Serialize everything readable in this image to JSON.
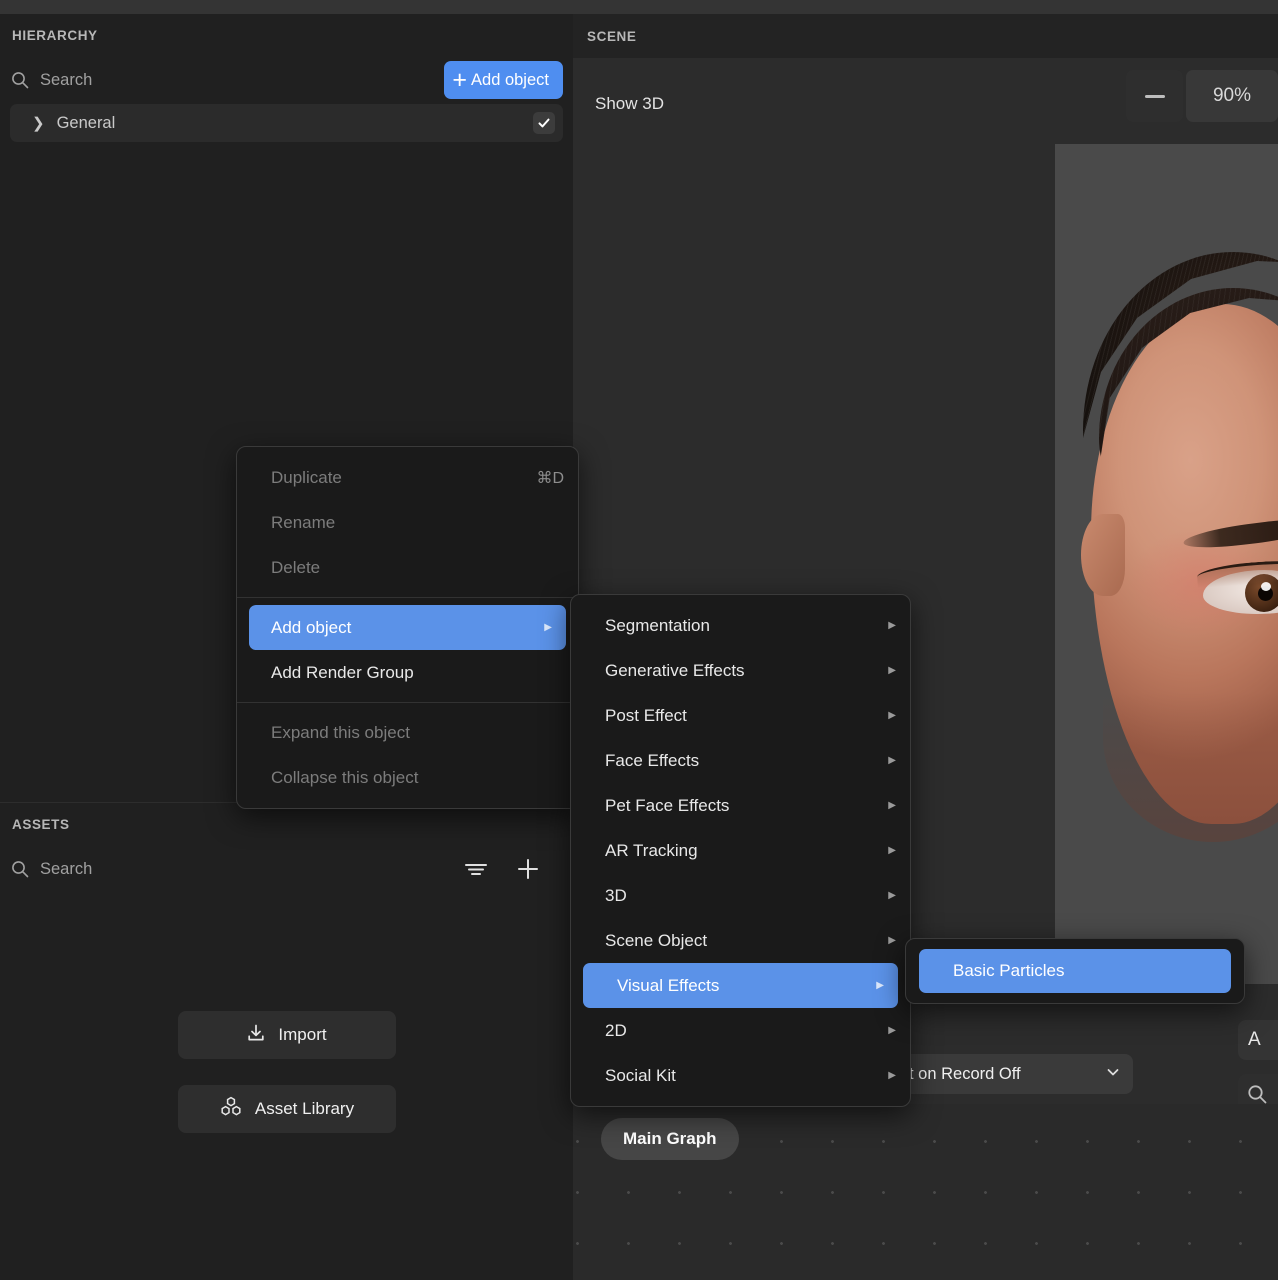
{
  "hierarchy": {
    "title": "HIERARCHY",
    "search_placeholder": "Search",
    "add_object_label": "Add object",
    "tree": [
      {
        "label": "General",
        "expanded": false,
        "enabled": true
      }
    ]
  },
  "assets": {
    "title": "ASSETS",
    "search_placeholder": "Search",
    "import_label": "Import",
    "asset_library_label": "Asset Library"
  },
  "scene": {
    "title": "SCENE",
    "show_3d_label": "Show 3D",
    "zoom_level": "90%",
    "zoom_out_label": "—"
  },
  "bottom": {
    "dropdown_value": "t on Record Off",
    "right_partial_label": "A",
    "graph_chip_label": "Main Graph"
  },
  "context_menu": {
    "items": [
      {
        "label": "Duplicate",
        "shortcut": "⌘D",
        "state": "disabled"
      },
      {
        "label": "Rename",
        "shortcut": "",
        "state": "disabled"
      },
      {
        "label": "Delete",
        "shortcut": "",
        "state": "disabled"
      },
      {
        "separator": true
      },
      {
        "label": "Add object",
        "shortcut": "",
        "state": "selected",
        "submenu": true
      },
      {
        "label": "Add Render Group",
        "shortcut": "",
        "state": "normal"
      },
      {
        "separator": true
      },
      {
        "label": "Expand this object",
        "shortcut": "",
        "state": "disabled"
      },
      {
        "label": "Collapse this object",
        "shortcut": "",
        "state": "disabled"
      }
    ]
  },
  "add_object_submenu": {
    "items": [
      {
        "label": "Segmentation",
        "state": "normal",
        "submenu": true
      },
      {
        "label": "Generative Effects",
        "state": "normal",
        "submenu": true
      },
      {
        "label": "Post Effect",
        "state": "normal",
        "submenu": true
      },
      {
        "label": "Face Effects",
        "state": "normal",
        "submenu": true
      },
      {
        "label": "Pet Face Effects",
        "state": "normal",
        "submenu": true
      },
      {
        "label": "AR Tracking",
        "state": "normal",
        "submenu": true
      },
      {
        "label": "3D",
        "state": "normal",
        "submenu": true
      },
      {
        "label": "Scene Object",
        "state": "normal",
        "submenu": true
      },
      {
        "label": "Visual Effects",
        "state": "selected",
        "submenu": true
      },
      {
        "label": "2D",
        "state": "normal",
        "submenu": true
      },
      {
        "label": "Social Kit",
        "state": "normal",
        "submenu": true
      }
    ]
  },
  "visual_effects_submenu": {
    "items": [
      {
        "label": "Basic Particles",
        "state": "selected"
      }
    ]
  },
  "colors": {
    "accent_blue": "#5b92e8",
    "button_blue": "#4f8ef0",
    "panel_bg": "#202020",
    "scene_bg": "#2c2c2c",
    "menu_bg": "#1a1a1a"
  }
}
